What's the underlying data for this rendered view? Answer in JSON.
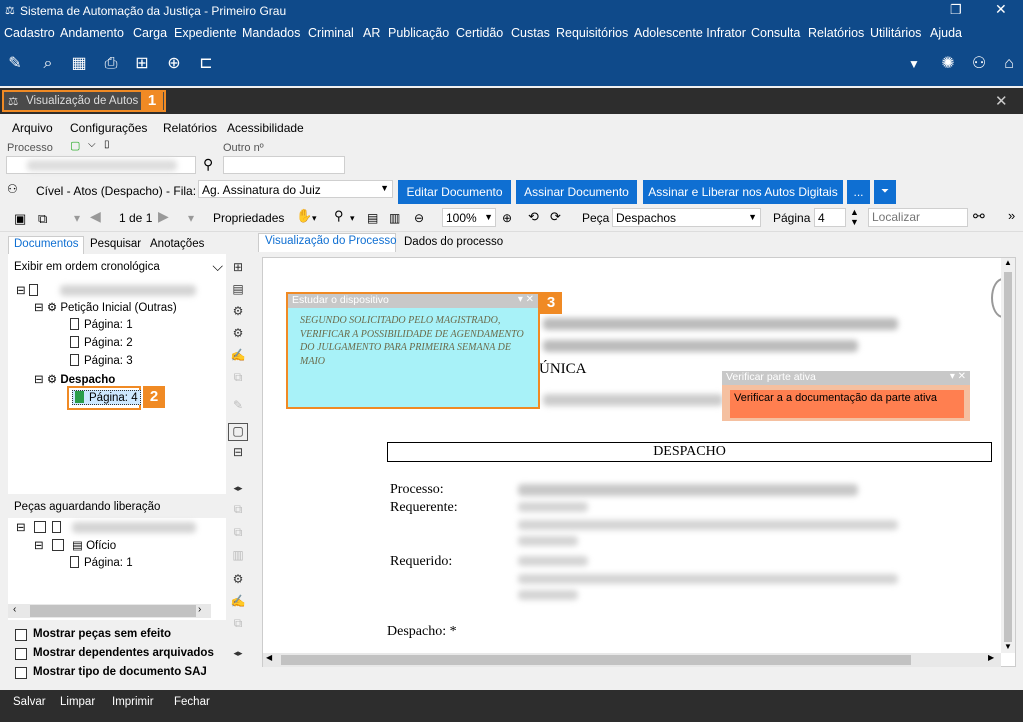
{
  "app_title": "Sistema de Automação da Justiça - Primeiro Grau",
  "menu": [
    "Cadastro",
    "Andamento",
    "Carga",
    "Expediente",
    "Mandados",
    "Criminal",
    "AR",
    "Publicação",
    "Certidão",
    "Custas",
    "Requisitórios",
    "Adolescente Infrator",
    "Consulta",
    "Relatórios",
    "Utilitários",
    "Ajuda"
  ],
  "window": {
    "title": "Visualização de Autos",
    "badge1": "1",
    "badge2": "2",
    "badge3": "3"
  },
  "submenu": [
    "Arquivo",
    "Configurações",
    "Relatórios",
    "Acessibilidade"
  ],
  "fields": {
    "processo_label": "Processo",
    "outro_label": "Outro nº"
  },
  "fila": {
    "text": "Cível - Atos (Despacho) - Fila:",
    "value": "Ag. Assinatura do Juiz"
  },
  "buttons": {
    "editar": "Editar Documento",
    "assinar": "Assinar Documento",
    "assinar_liberar": "Assinar e Liberar nos Autos Digitais",
    "more": "..."
  },
  "toolbar": {
    "page_of": "1 de 1",
    "propriedades": "Propriedades",
    "zoom": "100%",
    "peca_label": "Peça",
    "peca_value": "Despachos",
    "pagina_label": "Página",
    "pagina_value": "4",
    "localizar_placeholder": "Localizar"
  },
  "left_tabs": [
    "Documentos",
    "Pesquisar",
    "Anotações"
  ],
  "order_select": "Exibir em ordem cronológica",
  "tree": {
    "peticao": "Petição Inicial (Outras)",
    "p1": "Página: 1",
    "p2": "Página: 2",
    "p3": "Página: 3",
    "despacho": "Despacho",
    "p4": "Página: 4"
  },
  "pending": {
    "header": "Peças aguardando liberação",
    "oficio": "Ofício",
    "p1": "Página: 1"
  },
  "checkboxes": [
    "Mostrar peças sem efeito",
    "Mostrar dependentes arquivados",
    "Mostrar tipo de documento SAJ"
  ],
  "doc_tabs": [
    "Visualização do Processo",
    "Dados do processo"
  ],
  "note1": {
    "title": "Estudar o dispositivo",
    "body": "SEGUNDO SOLICITADO PELO MAGISTRADO, VERIFICAR A POSSIBILIDADE DE AGENDAMENTO DO JULGAMENTO PARA PRIMEIRA SEMANA DE MAIO"
  },
  "note2": {
    "title": "Verificar parte ativa",
    "body": "Verificar a a documentação da parte ativa"
  },
  "document": {
    "unica": "ÚNICA",
    "heading": "DESPACHO",
    "processo": "Processo:",
    "requerente": "Requerente:",
    "requerido": "Requerido:",
    "despacho": "Despacho: *"
  },
  "status": [
    "Salvar",
    "Limpar",
    "Imprimir",
    "Fechar"
  ]
}
